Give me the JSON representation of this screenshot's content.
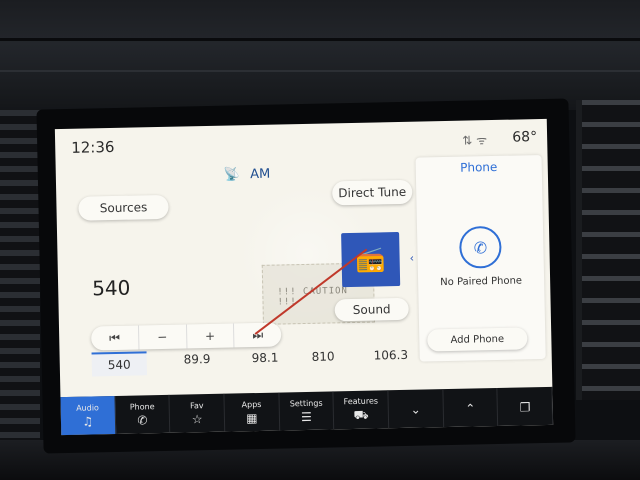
{
  "status": {
    "time": "12:36",
    "temperature": "68°",
    "icons": "⇅ ᯤ"
  },
  "source": {
    "icon": "📡",
    "label": "AM"
  },
  "buttons": {
    "sources": "Sources",
    "direct_tune": "Direct Tune",
    "sound": "Sound",
    "add_phone": "Add Phone"
  },
  "tuner": {
    "current_frequency": "540"
  },
  "controls": {
    "seek_back": "⏮",
    "minus": "−",
    "plus": "+",
    "seek_forward": "⏭"
  },
  "presets": [
    "540",
    "89.9",
    "98.1",
    "810",
    "106.3"
  ],
  "sticker": {
    "caution": "!!! CAUTION !!!"
  },
  "phone_panel": {
    "title": "Phone",
    "status": "No Paired Phone",
    "icon": "phone-icon"
  },
  "nav": [
    {
      "label": "Audio",
      "glyph": "♫"
    },
    {
      "label": "Phone",
      "glyph": "✆"
    },
    {
      "label": "Fav",
      "glyph": "☆"
    },
    {
      "label": "Apps",
      "glyph": "▦"
    },
    {
      "label": "Settings",
      "glyph": "☰"
    },
    {
      "label": "Features",
      "glyph": "⛟"
    },
    {
      "label": "",
      "glyph": "⌄"
    },
    {
      "label": "",
      "glyph": "⌃"
    },
    {
      "label": "",
      "glyph": "❐"
    }
  ],
  "colors": {
    "accent": "#2f6fd6",
    "screen_bg": "#f6f4ec",
    "nav_bg": "#111316"
  }
}
